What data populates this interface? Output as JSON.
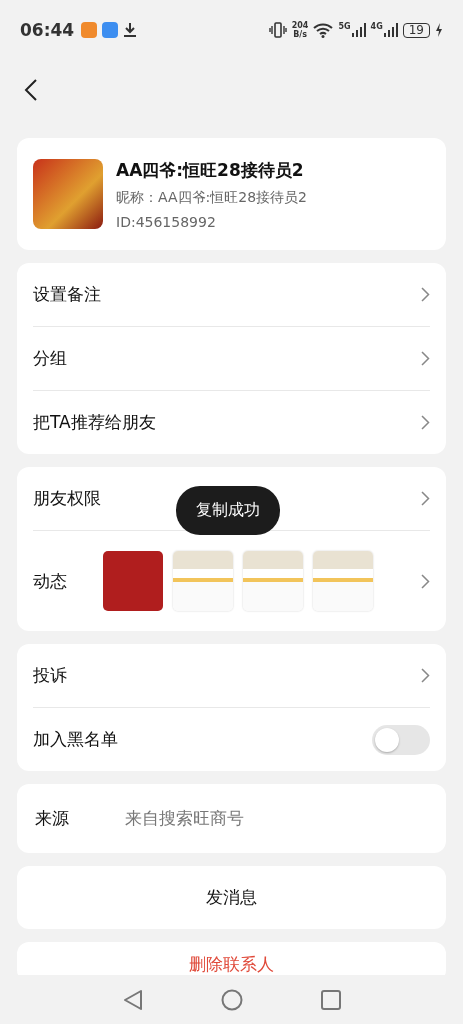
{
  "status_bar": {
    "time": "06:44",
    "net_speed": "204\nB/s",
    "network_1": "5G",
    "network_2": "4G",
    "battery": "19",
    "charging": true
  },
  "profile": {
    "name": "AA四爷:恒旺28接待员2",
    "nickname": "昵称：AA四爷:恒旺28接待员2",
    "id": "ID:456158992"
  },
  "groups": [
    [
      {
        "kind": "link",
        "label": "设置备注"
      },
      {
        "kind": "link",
        "label": "分组"
      },
      {
        "kind": "link",
        "label": "把TA推荐给朋友"
      }
    ],
    [
      {
        "kind": "link",
        "label": "朋友权限"
      },
      {
        "kind": "moments",
        "label": "动态",
        "thumbnails": [
          {
            "kind": "banner"
          },
          {
            "kind": "document"
          },
          {
            "kind": "document"
          },
          {
            "kind": "document"
          }
        ]
      }
    ],
    [
      {
        "kind": "link",
        "label": "投诉"
      },
      {
        "kind": "toggle",
        "label": "加入黑名单",
        "on": false
      }
    ],
    [
      {
        "kind": "info",
        "label": "来源",
        "value": "来自搜索旺商号"
      }
    ]
  ],
  "send_button": "发消息",
  "delete_button": "删除联系人",
  "toast": "复制成功"
}
